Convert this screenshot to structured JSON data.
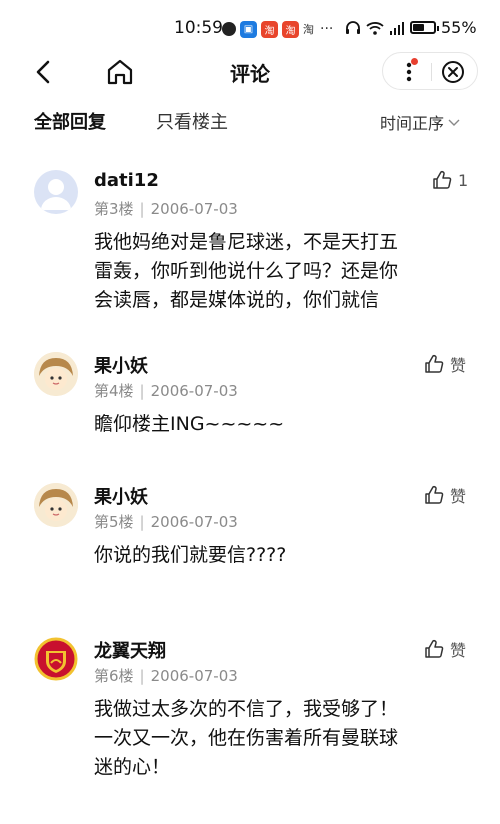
{
  "status_bar": {
    "time": "10:59",
    "taobao": "淘",
    "more": "···",
    "battery": "55%"
  },
  "header": {
    "title": "评论"
  },
  "tabs": {
    "all": "全部回复",
    "owner_only": "只看楼主",
    "sort": "时间正序"
  },
  "comments": [
    {
      "user": "dati12",
      "floor": "第3楼",
      "date": "2006-07-03",
      "like": "1",
      "lines": [
        "我他妈绝对是鲁尼球迷，不是天打五",
        "雷轰，你听到他说什么了吗？还是你",
        "会读唇，都是媒体说的，你们就信"
      ]
    },
    {
      "user": "果小妖",
      "floor": "第4楼",
      "date": "2006-07-03",
      "like": "赞",
      "lines": [
        "瞻仰楼主ING~~~~~"
      ]
    },
    {
      "user": "果小妖",
      "floor": "第5楼",
      "date": "2006-07-03",
      "like": "赞",
      "lines": [
        "你说的我们就要信????"
      ]
    },
    {
      "user": "龙翼天翔",
      "floor": "第6楼",
      "date": "2006-07-03",
      "like": "赞",
      "lines": [
        "我做过太多次的不信了，我受够了！",
        "一次又一次，他在伤害着所有曼联球",
        "迷的心！"
      ]
    }
  ],
  "colors": {
    "accent_red": "#e84030",
    "meta_gray": "#8a8a8a",
    "club_red": "#c8102e",
    "club_gold": "#f2c230"
  }
}
